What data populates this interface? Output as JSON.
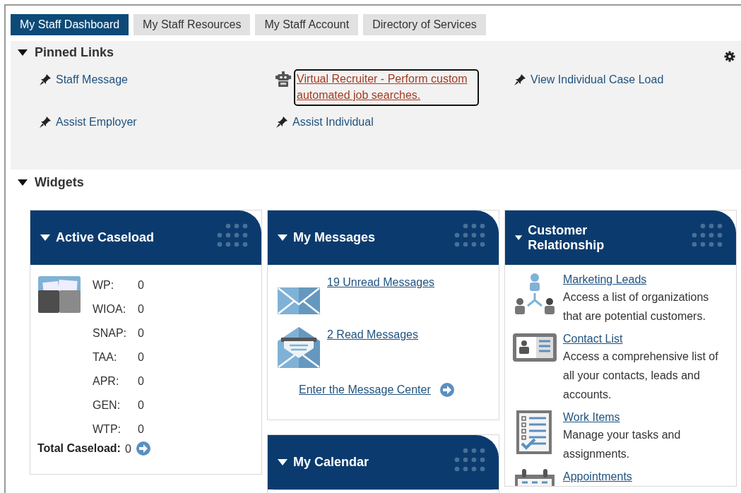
{
  "tabs": [
    {
      "label": "My Staff Dashboard",
      "selected": true
    },
    {
      "label": "My Staff Resources",
      "selected": false
    },
    {
      "label": "My Staff Account",
      "selected": false
    },
    {
      "label": "Directory of Services",
      "selected": false
    }
  ],
  "pinned_links": {
    "title": "Pinned Links",
    "expanded": true,
    "items": [
      {
        "label": "Staff Message",
        "kind": "pin",
        "focused": false
      },
      {
        "label": "Virtual Recruiter - Perform custom automated job searches.",
        "kind": "robot",
        "focused": true
      },
      {
        "label": "View Individual Case Load",
        "kind": "pin",
        "focused": false
      },
      {
        "label": "Assist Employer",
        "kind": "pin",
        "focused": false
      },
      {
        "label": "Assist Individual",
        "kind": "pin",
        "focused": false
      }
    ]
  },
  "widgets": {
    "title": "Widgets",
    "expanded": true,
    "columns": [
      [
        {
          "kind": "caseload",
          "title": "Active Caseload",
          "expanded": true,
          "rows": [
            {
              "label": "WP:",
              "value": "0"
            },
            {
              "label": "WIOA:",
              "value": "0"
            },
            {
              "label": "SNAP:",
              "value": "0"
            },
            {
              "label": "TAA:",
              "value": "0"
            },
            {
              "label": "APR:",
              "value": "0"
            },
            {
              "label": "GEN:",
              "value": "0"
            },
            {
              "label": "WTP:",
              "value": "0"
            }
          ],
          "total_label": "Total Caseload:",
          "total_value": "0"
        }
      ],
      [
        {
          "kind": "messages",
          "title": "My Messages",
          "expanded": true,
          "items": [
            {
              "label": "19 Unread Messages",
              "kind": "closed"
            },
            {
              "label": "2 Read Messages",
              "kind": "open"
            }
          ],
          "center_link": "Enter the Message Center"
        },
        {
          "kind": "calendar",
          "title": "My Calendar",
          "expanded": true
        }
      ],
      [
        {
          "kind": "crm",
          "title": "Customer Relationship",
          "expanded": true,
          "items": [
            {
              "kind": "leads",
              "link": "Marketing Leads",
              "description": "Access a list of organizations that are potential customers."
            },
            {
              "kind": "contacts",
              "link": "Contact List",
              "description": "Access a comprehensive list of all your contacts, leads and accounts."
            },
            {
              "kind": "work",
              "link": "Work Items",
              "description": "Manage your tasks and assignments."
            },
            {
              "kind": "appointments",
              "link": "Appointments"
            }
          ]
        }
      ]
    ]
  }
}
